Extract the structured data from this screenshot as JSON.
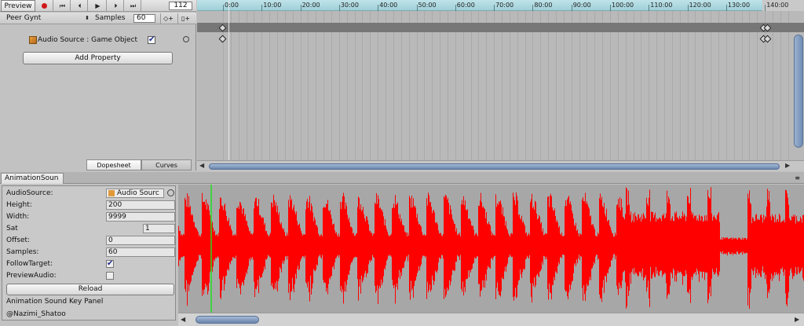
{
  "toolbar": {
    "preview_label": "Preview",
    "frame_value": "112",
    "rewind_glyph": "⏮",
    "prev_glyph": "⏴",
    "play_glyph": "▶",
    "next_glyph": "⏵",
    "end_glyph": "⏭"
  },
  "clip_bar": {
    "clip_name": "Peer Gynt",
    "samples_label": "Samples",
    "samples_value": "60",
    "add_key_glyph": "◇+",
    "add_event_glyph": "▯+"
  },
  "property": {
    "label": "Audio Source : Game Object",
    "checked_glyph": "✔"
  },
  "add_property_label": "Add Property",
  "view_tabs": {
    "dopesheet": "Dopesheet",
    "curves": "Curves"
  },
  "ruler": {
    "ticks": [
      "0:00",
      "10:00",
      "20:00",
      "30:00",
      "40:00",
      "50:00",
      "60:00",
      "70:00",
      "80:00",
      "90:00",
      "100:00",
      "110:00",
      "120:00",
      "130:00",
      "140:00"
    ]
  },
  "bottom_panel": {
    "tab_label": "AnimationSoun",
    "menu_glyph": "≡"
  },
  "inspector": {
    "audio_source_label": "AudioSource:",
    "audio_source_value": "Audio Sourc",
    "height_label": "Height:",
    "height_value": "200",
    "width_label": "Width:",
    "width_value": "9999",
    "sat_label": "Sat",
    "sat_value": "1",
    "offset_label": "Offset:",
    "offset_value": "0",
    "samples_label": "Samples:",
    "samples_value": "60",
    "follow_label": "FollowTarget:",
    "follow_checked": true,
    "preview_label": "PreviewAudio:",
    "preview_checked": false,
    "reload_label": "Reload",
    "footer_title": "Animation Sound Key Panel",
    "footer_author": "@Nazimi_Shatoo"
  },
  "colors": {
    "waveform": "#ff0000",
    "wave_background": "#a7a7a7",
    "cursor": "#22dd22",
    "ruler": "#a9d6dd",
    "record": "#d01919"
  }
}
